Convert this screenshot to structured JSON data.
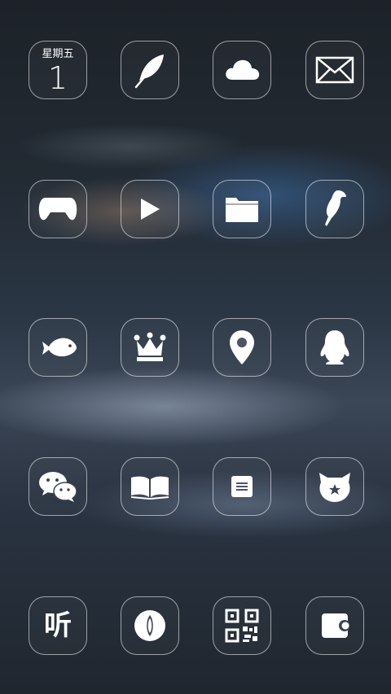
{
  "home_screen": {
    "apps": [
      {
        "id": "calendar",
        "weekday": "星期五",
        "day": "1"
      },
      {
        "id": "notes",
        "icon": "feather-icon"
      },
      {
        "id": "cloud",
        "icon": "cloud-icon"
      },
      {
        "id": "mail",
        "icon": "envelope-icon"
      },
      {
        "id": "games",
        "icon": "gamepad-icon"
      },
      {
        "id": "video",
        "icon": "play-icon"
      },
      {
        "id": "files",
        "icon": "folder-icon"
      },
      {
        "id": "bird-app",
        "icon": "parrot-icon"
      },
      {
        "id": "fish-app",
        "icon": "fish-icon"
      },
      {
        "id": "crown-app",
        "icon": "crown-icon"
      },
      {
        "id": "maps",
        "icon": "location-pin-icon"
      },
      {
        "id": "qq",
        "icon": "penguin-icon"
      },
      {
        "id": "wechat",
        "icon": "chat-bubbles-icon"
      },
      {
        "id": "reader",
        "icon": "open-book-icon"
      },
      {
        "id": "notes-list",
        "icon": "memo-icon"
      },
      {
        "id": "mi-community",
        "icon": "mi-bunny-icon"
      },
      {
        "id": "listen",
        "label": "听"
      },
      {
        "id": "browser",
        "icon": "compass-icon"
      },
      {
        "id": "scanner",
        "icon": "qr-code-icon"
      },
      {
        "id": "wallet",
        "icon": "wallet-icon"
      }
    ]
  },
  "colors": {
    "icon": "#ffffff",
    "border": "rgba(255,255,255,0.55)"
  }
}
